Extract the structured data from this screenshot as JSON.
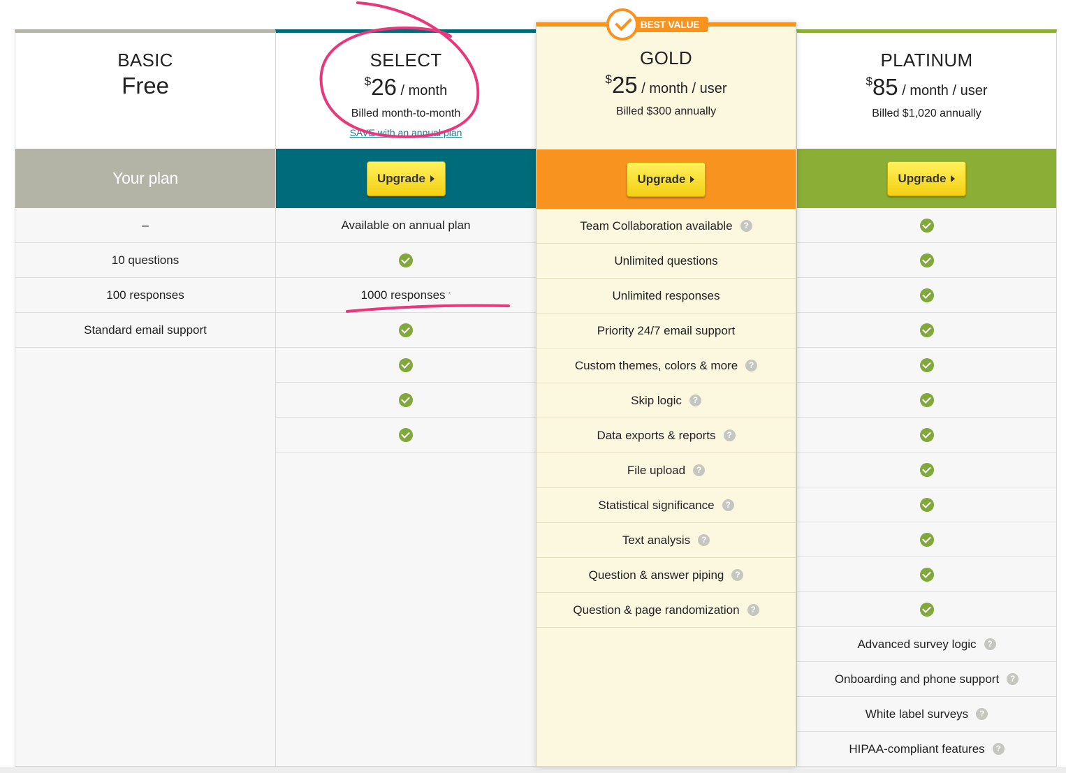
{
  "badge": {
    "label": "BEST VALUE"
  },
  "plans": {
    "basic": {
      "name": "BASIC",
      "price_label": "Free",
      "action_label": "Your plan",
      "rows": [
        "–",
        "10 questions",
        "100 responses",
        "Standard email support"
      ]
    },
    "select": {
      "name": "SELECT",
      "currency": "$",
      "price": "26",
      "period": " / month",
      "billed": "Billed month-to-month",
      "save_link": "SAVE with an annual plan",
      "action_label": "Upgrade",
      "rows": [
        "Available on annual plan",
        "check",
        "1000 responses",
        "check",
        "check",
        "check",
        "check"
      ],
      "responses_note": "*"
    },
    "gold": {
      "name": "GOLD",
      "currency": "$",
      "price": "25",
      "period": " / month / user",
      "billed": "Billed $300 annually",
      "action_label": "Upgrade",
      "rows": [
        "Team Collaboration available",
        "Unlimited questions",
        "Unlimited responses",
        "Priority 24/7 email support",
        "Custom themes, colors & more",
        "Skip logic",
        "Data exports & reports",
        "File upload",
        "Statistical significance",
        "Text analysis",
        "Question & answer piping",
        "Question & page randomization"
      ]
    },
    "platinum": {
      "name": "PLATINUM",
      "currency": "$",
      "price": "85",
      "period": " / month / user",
      "billed": "Billed $1,020 annually",
      "action_label": "Upgrade",
      "rows": [
        "Advanced survey logic",
        "Onboarding and phone support",
        "White label surveys",
        "HIPAA-compliant features"
      ]
    }
  },
  "help_glyph": "?",
  "colors": {
    "basic": "#b3b3a6",
    "select": "#006b7a",
    "gold": "#f7931e",
    "platinum": "#8aae36",
    "check": "#80a83a",
    "upgrade_button": "#f3cf12",
    "annotation": "#e8377a"
  }
}
